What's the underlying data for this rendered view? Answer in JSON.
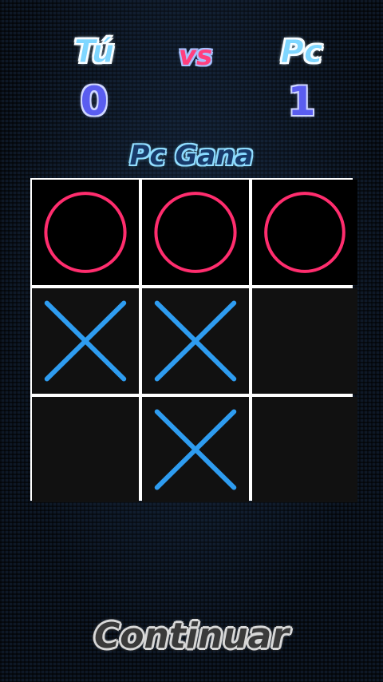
{
  "scoreboard": {
    "player_label": "Tú",
    "player_score": "0",
    "vs_label": "vs",
    "opponent_label": "Pc",
    "opponent_score": "1"
  },
  "status_text": "Pc Gana",
  "board": {
    "cells": [
      [
        "O",
        "O",
        "O"
      ],
      [
        "X",
        "X",
        ""
      ],
      [
        "",
        "X",
        ""
      ]
    ],
    "colors": {
      "o_mark": "#ff2d6e",
      "x_mark": "#2e9cf0",
      "grid_line": "#ffffff",
      "cell_bg": "#111111"
    }
  },
  "actions": {
    "continue_label": "Continuar"
  }
}
